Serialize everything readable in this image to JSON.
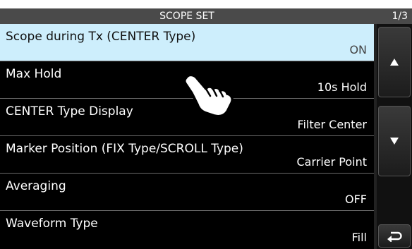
{
  "header": {
    "title": "SCOPE SET",
    "page": "1/3"
  },
  "items": [
    {
      "label": "Scope during Tx (CENTER Type)",
      "value": "ON"
    },
    {
      "label": "Max Hold",
      "value": "10s Hold"
    },
    {
      "label": "CENTER Type Display",
      "value": "Filter Center"
    },
    {
      "label": "Marker Position (FIX Type/SCROLL Type)",
      "value": "Carrier Point"
    },
    {
      "label": "Averaging",
      "value": "OFF"
    },
    {
      "label": "Waveform Type",
      "value": "Fill"
    }
  ],
  "icons": {
    "up": "triangle-up-icon",
    "down": "triangle-down-icon",
    "back": "return-arrow-icon",
    "hand": "pointing-hand-icon"
  },
  "colors": {
    "selected_bg": "#cdeefc",
    "header_bg": "#4a4a4a"
  }
}
